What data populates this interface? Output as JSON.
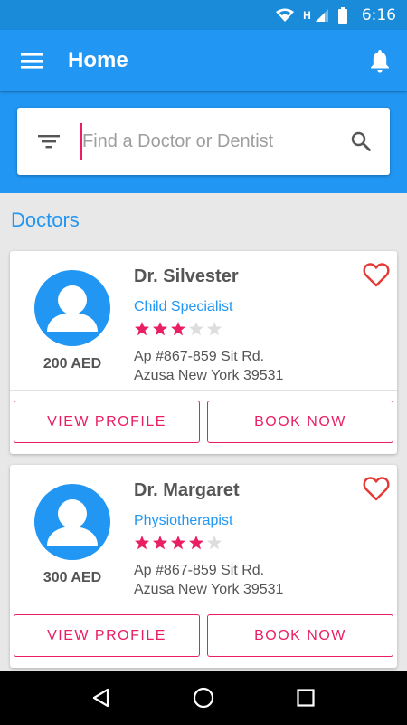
{
  "status_bar": {
    "time": "6:16",
    "network_label": "H",
    "icons": [
      "wifi-icon",
      "signal-icon",
      "battery-icon"
    ]
  },
  "app_bar": {
    "title": "Home",
    "menu_icon": "menu-icon",
    "bell_icon": "bell-icon"
  },
  "search": {
    "placeholder": "Find a Doctor or Dentist",
    "value": "",
    "filter_icon": "filter-icon",
    "search_icon": "search-icon"
  },
  "section": {
    "title": "Doctors"
  },
  "doctors": [
    {
      "name": "Dr. Silvester",
      "specialty": "Child Specialist",
      "rating": 3,
      "rating_max": 5,
      "price": "200 AED",
      "address_line1": "Ap #867-859 Sit Rd.",
      "address_line2": "Azusa New York 39531",
      "view_label": "VIEW PROFILE",
      "book_label": "BOOK NOW"
    },
    {
      "name": "Dr. Margaret",
      "specialty": "Physiotherapist",
      "rating": 4,
      "rating_max": 5,
      "price": "300 AED",
      "address_line1": "Ap #867-859 Sit Rd.",
      "address_line2": "Azusa New York 39531",
      "view_label": "VIEW PROFILE",
      "book_label": "BOOK NOW"
    }
  ],
  "nav_bar": {
    "icons": [
      "back-icon",
      "home-icon",
      "recents-icon"
    ]
  },
  "colors": {
    "primary": "#2196f3",
    "status_bar": "#1a8bd9",
    "accent": "#e91e63",
    "star_empty": "#dddddd",
    "card_bg": "#ffffff",
    "page_bg": "#e8e8e8"
  }
}
